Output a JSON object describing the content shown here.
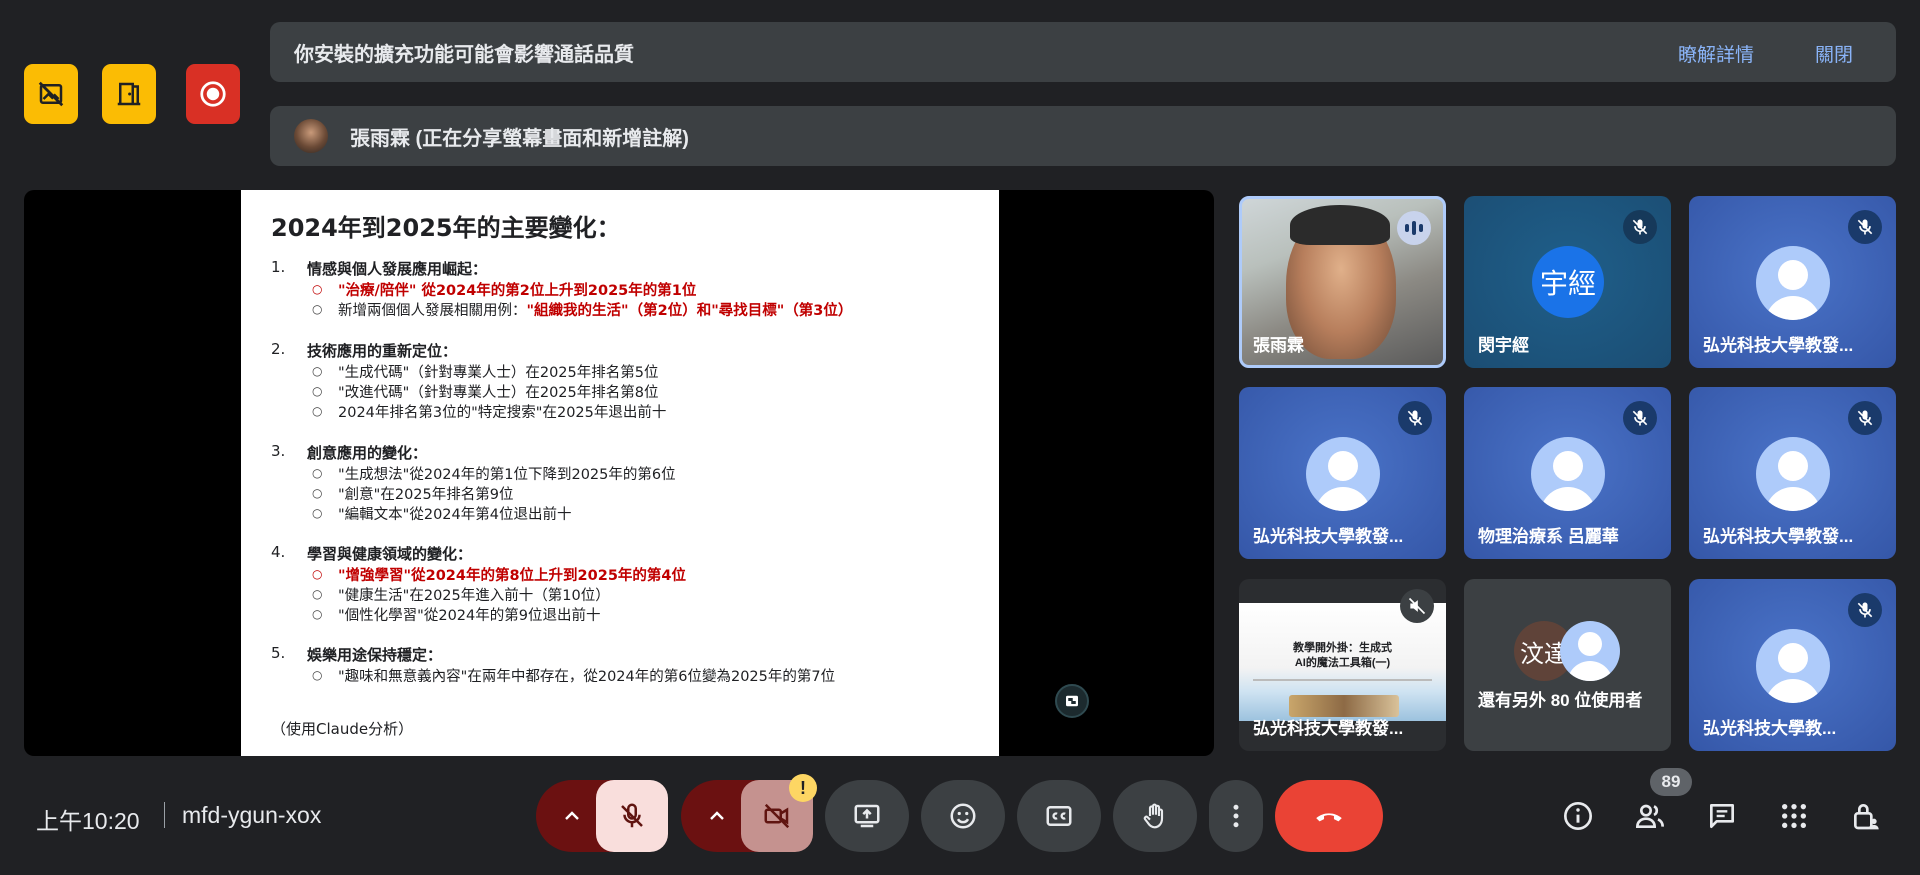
{
  "banners": {
    "extension_warning": "你安裝的擴充功能可能會影響通話品質",
    "learn_more": "瞭解詳情",
    "close": "關閉",
    "presenter_text": "張雨霖 (正在分享螢幕畫面和新增註解)"
  },
  "slide": {
    "title": "2024年到2025年的主要變化：",
    "sections": [
      {
        "num": "1.",
        "head": "情感與個人發展應用崛起：",
        "items": [
          {
            "text": "\"治療/陪伴\" 從2024年的第2位上升到2025年的第1位",
            "highlight": true
          },
          {
            "prefix": "新增兩個個人發展相關用例：",
            "text": "\"組織我的生活\"（第2位）和\"尋找目標\"（第3位）",
            "highlight": true
          }
        ]
      },
      {
        "num": "2.",
        "head": "技術應用的重新定位：",
        "items": [
          {
            "text": "\"生成代碼\"（針對專業人士）在2025年排名第5位"
          },
          {
            "text": "\"改進代碼\"（針對專業人士）在2025年排名第8位"
          },
          {
            "text": "2024年排名第3位的\"特定搜索\"在2025年退出前十"
          }
        ]
      },
      {
        "num": "3.",
        "head": "創意應用的變化：",
        "items": [
          {
            "text": "\"生成想法\"從2024年的第1位下降到2025年的第6位"
          },
          {
            "text": "\"創意\"在2025年排名第9位"
          },
          {
            "text": "\"編輯文本\"從2024年第4位退出前十"
          }
        ]
      },
      {
        "num": "4.",
        "head": "學習與健康領域的變化：",
        "items": [
          {
            "text": "\"增強學習\"從2024年的第8位上升到2025年的第4位",
            "highlight": true
          },
          {
            "text": "\"健康生活\"在2025年進入前十（第10位）"
          },
          {
            "text": "\"個性化學習\"從2024年的第9位退出前十"
          }
        ]
      },
      {
        "num": "5.",
        "head": "娛樂用途保持穩定：",
        "items": [
          {
            "text": "\"趣味和無意義內容\"在兩年中都存在，從2024年的第6位變為2025年的第7位"
          }
        ]
      }
    ],
    "footer": "（使用Claude分析）"
  },
  "tiles": [
    {
      "name": "張雨霖",
      "type": "video"
    },
    {
      "name": "閔宇經",
      "type": "initials",
      "initials": "宇經"
    },
    {
      "name": "弘光科技大學教發...",
      "type": "avatar"
    },
    {
      "name": "弘光科技大學教發...",
      "type": "avatar"
    },
    {
      "name": "物理治療系 呂麗華",
      "type": "avatar"
    },
    {
      "name": "弘光科技大學教發...",
      "type": "avatar"
    },
    {
      "name": "弘光科技大學教發...",
      "type": "thumbnail",
      "thumb_title_1": "教學開外掛：生成式",
      "thumb_title_2": "AI的魔法工具箱(一)"
    },
    {
      "name": "還有另外 80 位使用者",
      "type": "others",
      "initials": "汶達"
    },
    {
      "name": "弘光科技大學教...",
      "type": "avatar"
    }
  ],
  "bottom": {
    "time": "上午10:20",
    "meeting_code": "mfd-ygun-xox",
    "people_count": "89",
    "camera_warning": "!"
  },
  "colors": {
    "host_yellow": "#fbbc04",
    "record_red": "#d93025",
    "leave_red": "#ea4335",
    "mic_off_bg": "#f9dedc",
    "mic_chevron_bg": "#6b1111",
    "slide_highlight": "#c00000"
  }
}
